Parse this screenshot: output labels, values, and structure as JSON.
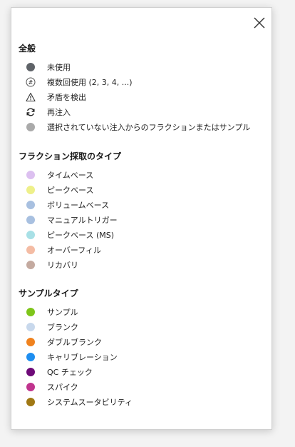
{
  "sections": [
    {
      "title": "全般",
      "items": [
        {
          "label": "未使用",
          "icon": "dot",
          "color": "#5f6368"
        },
        {
          "label": "複数回使用 (2, 3, 4, ...)",
          "icon": "hash-circle-icon"
        },
        {
          "label": "矛盾を検出",
          "icon": "warning-icon"
        },
        {
          "label": "再注入",
          "icon": "refresh-icon"
        },
        {
          "label": "選択されていない注入からのフラクションまたはサンプル",
          "icon": "dot",
          "color": "#aaaaaa"
        }
      ]
    },
    {
      "title": "フラクション採取のタイプ",
      "items": [
        {
          "label": "タイムベース",
          "icon": "dot",
          "color": "#dcc0f0"
        },
        {
          "label": "ピークベース",
          "icon": "dot",
          "color": "#eef08a"
        },
        {
          "label": "ボリュームベース",
          "icon": "dot",
          "color": "#a8c0e0"
        },
        {
          "label": "マニュアルトリガー",
          "icon": "dot",
          "color": "#a8c0e0"
        },
        {
          "label": "ピークベース (MS)",
          "icon": "dot",
          "color": "#a8e0e6"
        },
        {
          "label": "オーバーフィル",
          "icon": "dot",
          "color": "#f4bca4"
        },
        {
          "label": "リカバリ",
          "icon": "dot",
          "color": "#c4aaa0"
        }
      ]
    },
    {
      "title": "サンプルタイプ",
      "items": [
        {
          "label": "サンプル",
          "icon": "dot",
          "color": "#7ec51a"
        },
        {
          "label": "ブランク",
          "icon": "dot",
          "color": "#c8d8ec"
        },
        {
          "label": "ダブルブランク",
          "icon": "dot",
          "color": "#f0821e"
        },
        {
          "label": "キャリブレーション",
          "icon": "dot",
          "color": "#1e8ef0"
        },
        {
          "label": "QC チェック",
          "icon": "dot",
          "color": "#6e0a78"
        },
        {
          "label": "スパイク",
          "icon": "dot",
          "color": "#c0348e"
        },
        {
          "label": "システムスータビリティ",
          "icon": "dot",
          "color": "#a07814"
        }
      ]
    }
  ]
}
